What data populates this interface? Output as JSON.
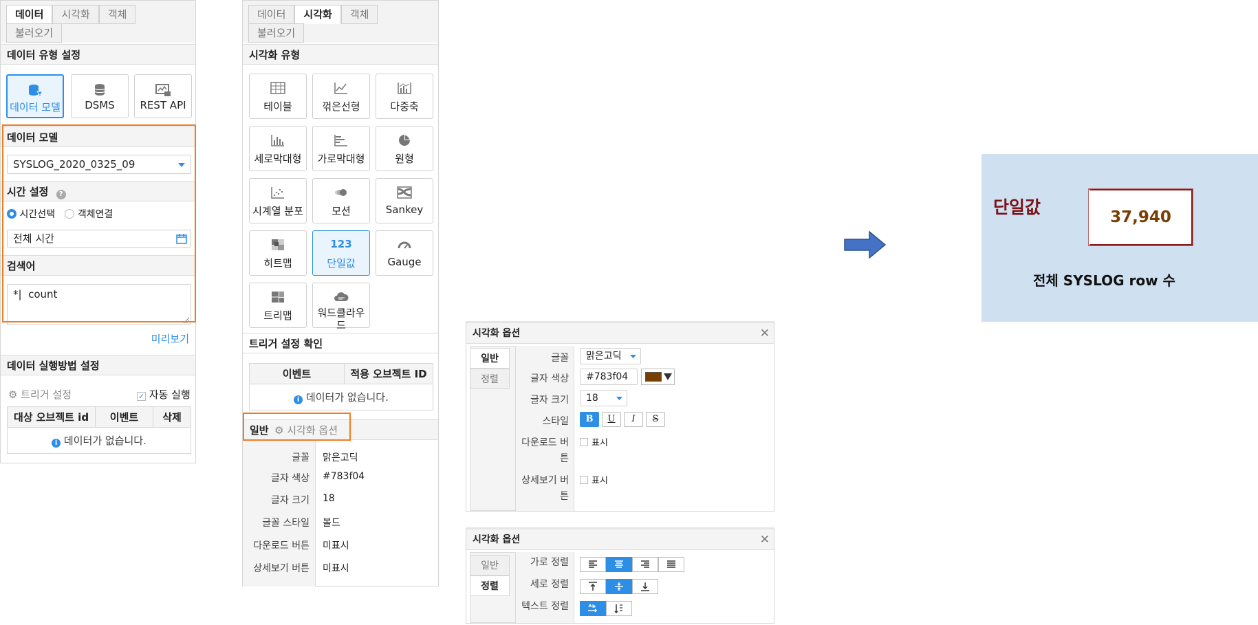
{
  "tabs": {
    "data": "데이터",
    "viz": "시각화",
    "obj": "객체",
    "load": "불러오기"
  },
  "left": {
    "datatype_title": "데이터 유형 설정",
    "sources": [
      "데이터 모델",
      "DSMS",
      "REST API"
    ],
    "model_title": "데이터 모델",
    "model_value": "SYSLOG_2020_0325_09",
    "time_title": "시간 설정",
    "time_radio1": "시간선택",
    "time_radio2": "객체연결",
    "time_value": "전체 시간",
    "search_title": "검색어",
    "search_value": "*|  count",
    "preview": "미리보기",
    "exec_title": "데이터 실행방법 설정",
    "trigger_label": "트리거 설정",
    "auto_label": "자동 실행",
    "table_headers": [
      "대상 오브젝트 id",
      "이벤트",
      "삭제"
    ],
    "empty": "데이터가 없습니다."
  },
  "mid": {
    "viz_title": "시각화 유형",
    "tiles": [
      "테이블",
      "꺾은선형",
      "다중축",
      "세로막대형",
      "가로막대형",
      "원형",
      "시계열 분포",
      "모션",
      "Sankey",
      "히트맵",
      "단일값",
      "Gauge",
      "트리맵",
      "워드클라우드"
    ],
    "tile_123": "123",
    "trigger_title": "트리거 설정 확인",
    "trigger_headers": [
      "이벤트",
      "적용 오브젝트 ID"
    ],
    "empty": "데이터가 없습니다.",
    "subtab_general": "일반",
    "subtab_vizopt": "시각화 옵션",
    "props": [
      {
        "k": "글꼴",
        "v": "맑은고딕"
      },
      {
        "k": "글자 색상",
        "v": "#783f04"
      },
      {
        "k": "글자 크기",
        "v": "18"
      },
      {
        "k": "글꼴 스타일",
        "v": "볼드"
      },
      {
        "k": "다운로드 버튼",
        "v": "미표시"
      },
      {
        "k": "상세보기 버튼",
        "v": "미표시"
      }
    ]
  },
  "dlg1": {
    "title": "시각화 옵션",
    "tab_general": "일반",
    "tab_align": "정렬",
    "font_label": "글꼴",
    "font_value": "맑은고딕",
    "color_label": "글자 색상",
    "color_value": "#783f04",
    "size_label": "글자 크기",
    "size_value": "18",
    "style_label": "스타일",
    "style_btns": [
      "B",
      "U",
      "I",
      "S"
    ],
    "dl_label1": "다운로드 버",
    "dl_label2": "튼",
    "detail_label1": "상세보기 버",
    "detail_label2": "튼",
    "show": "표시"
  },
  "dlg2": {
    "title": "시각화 옵션",
    "tab_general": "일반",
    "tab_align": "정렬",
    "h_label": "가로 정렬",
    "v_label": "세로 정렬",
    "t_label": "텍스트 정렬"
  },
  "preview": {
    "title": "단일값",
    "value": "37,940",
    "caption": "전체 SYSLOG row 수"
  },
  "colors": {
    "accent": "#2d8ee6",
    "highlight": "#f07d22",
    "text_color": "#783f04",
    "preview_bg": "#cfe0f1",
    "title_red": "#7a1419"
  }
}
